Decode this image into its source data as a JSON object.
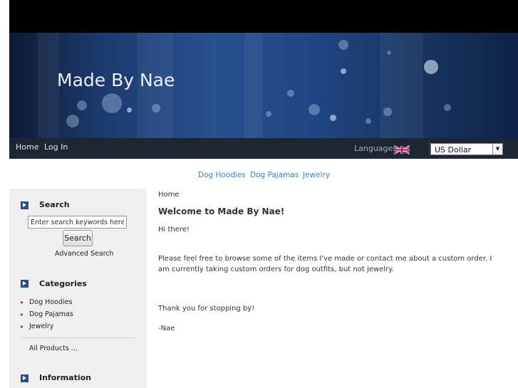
{
  "header": {
    "site_title": "Made By Nae"
  },
  "nav": {
    "home": "Home",
    "login": "Log In",
    "languages_label": "Languages",
    "currency_selected": "US Dollar"
  },
  "categories_nav": [
    "Dog Hoodies",
    "Dog Pajamas",
    "Jewelry"
  ],
  "sidebar": {
    "search": {
      "title": "Search",
      "input_value": "Enter search keywords here",
      "button_label": "Search",
      "advanced_label": "Advanced Search"
    },
    "categories": {
      "title": "Categories",
      "items": [
        "Dog Hoodies",
        "Dog Pajamas",
        "Jewelry"
      ],
      "all_products": "All Products ..."
    },
    "information": {
      "title": "Information"
    }
  },
  "main": {
    "breadcrumb": "Home",
    "heading": "Welcome to Made By Nae!",
    "greeting": "Hi there!",
    "body": "Please feel free to browse some of the items I've made or contact me about a custom order. I am currently taking custom orders for dog outfits, but not jewelry.",
    "thanks": "Thank you for stopping by!",
    "signature": "-Nae"
  },
  "colors": {
    "nav_bg": "#1d2633",
    "link": "#3a7fc4",
    "sidebar_bg": "#efefef",
    "box_icon": "#2b4f7e"
  }
}
